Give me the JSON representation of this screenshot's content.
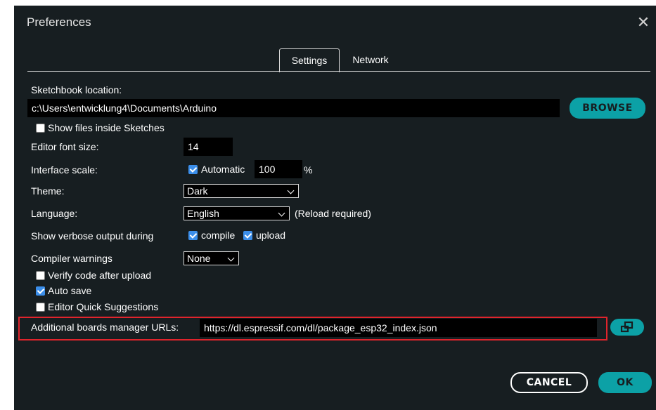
{
  "dialog": {
    "title": "Preferences",
    "close_icon": "close-icon"
  },
  "tabs": [
    {
      "label": "Settings",
      "active": true
    },
    {
      "label": "Network",
      "active": false
    }
  ],
  "sketchbook": {
    "label": "Sketchbook location:",
    "value": "c:\\Users\\entwicklung4\\Documents\\Arduino",
    "browse_label": "BROWSE"
  },
  "show_files": {
    "label": "Show files inside Sketches",
    "checked": false
  },
  "font_size": {
    "label": "Editor font size:",
    "value": "14"
  },
  "interface_scale": {
    "label": "Interface scale:",
    "automatic_label": "Automatic",
    "automatic_checked": true,
    "value": "100",
    "unit": "%"
  },
  "theme": {
    "label": "Theme:",
    "selected": "Dark"
  },
  "language": {
    "label": "Language:",
    "selected": "English",
    "note": "(Reload required)"
  },
  "verbose": {
    "label": "Show verbose output during",
    "compile_label": "compile",
    "compile_checked": true,
    "upload_label": "upload",
    "upload_checked": true
  },
  "compiler_warnings": {
    "label": "Compiler warnings",
    "selected": "None"
  },
  "verify_code": {
    "label": "Verify code after upload",
    "checked": false
  },
  "auto_save": {
    "label": "Auto save",
    "checked": true
  },
  "quick_suggestions": {
    "label": "Editor Quick Suggestions",
    "checked": false
  },
  "boards_urls": {
    "label": "Additional boards manager URLs:",
    "value": "https://dl.espressif.com/dl/package_esp32_index.json",
    "expand_icon": "open-in-window-icon"
  },
  "footer": {
    "cancel_label": "CANCEL",
    "ok_label": "OK"
  },
  "colors": {
    "background": "#171e21",
    "accent": "#0ca1a6",
    "highlight": "#e0242c",
    "checkbox": "#3b8eea"
  }
}
